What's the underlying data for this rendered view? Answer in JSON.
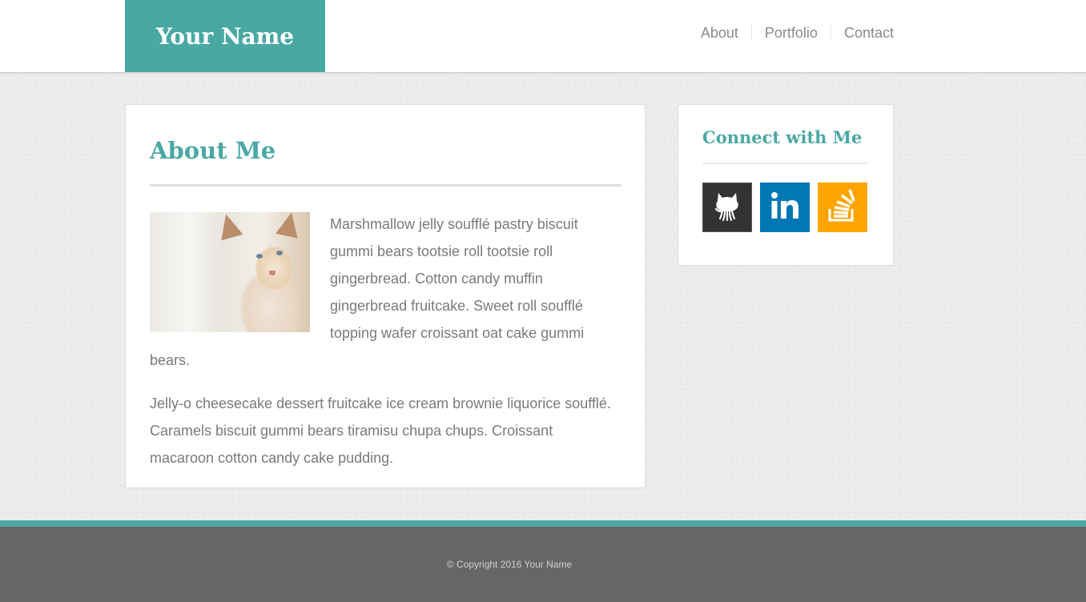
{
  "header": {
    "brand": "Your Name",
    "nav": [
      {
        "label": "About"
      },
      {
        "label": "Portfolio"
      },
      {
        "label": "Contact"
      }
    ]
  },
  "main": {
    "title": "About Me",
    "image_alt": "cat photo",
    "paragraphs": [
      "Marshmallow jelly soufflé pastry biscuit gummi bears tootsie roll tootsie roll gingerbread. Cotton candy muffin gingerbread fruitcake. Sweet roll soufflé topping wafer croissant oat cake gummi bears.",
      "Jelly-o cheesecake dessert fruitcake ice cream brownie liquorice soufflé. Caramels biscuit gummi bears tiramisu chupa chups. Croissant macaroon cotton candy cake pudding."
    ]
  },
  "sidebar": {
    "title": "Connect with Me",
    "socials": [
      {
        "name": "GitHub",
        "icon": "github-icon",
        "color": "#333333"
      },
      {
        "name": "LinkedIn",
        "icon": "linkedin-icon",
        "color": "#0077b5"
      },
      {
        "name": "Stack Overflow",
        "icon": "stackoverflow-icon",
        "color": "#fea400"
      }
    ]
  },
  "footer": {
    "copyright": "© Copyright 2016 Your Name"
  },
  "colors": {
    "accent": "#4aa8a3",
    "footer": "#666666"
  }
}
